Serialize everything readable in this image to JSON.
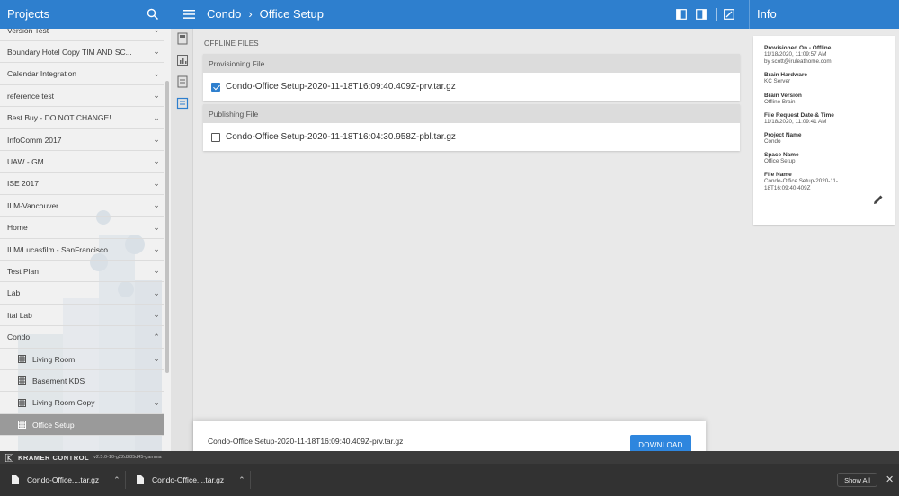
{
  "header": {
    "projects_title": "Projects",
    "breadcrumb": [
      "Condo",
      "Office Setup"
    ],
    "info_title": "Info"
  },
  "sidebar": {
    "items": [
      {
        "label": "Version Test",
        "chevron": "down"
      },
      {
        "label": "Boundary Hotel Copy TIM AND SC...",
        "chevron": "down"
      },
      {
        "label": "Calendar Integration",
        "chevron": "down"
      },
      {
        "label": "reference test",
        "chevron": "down"
      },
      {
        "label": "Best Buy - DO NOT CHANGE!",
        "chevron": "down"
      },
      {
        "label": "InfoComm 2017",
        "chevron": "down"
      },
      {
        "label": "UAW - GM",
        "chevron": "down"
      },
      {
        "label": "ISE 2017",
        "chevron": "down"
      },
      {
        "label": "ILM-Vancouver",
        "chevron": "down"
      },
      {
        "label": "Home",
        "chevron": "down"
      },
      {
        "label": "ILM/Lucasfilm - SanFrancisco",
        "chevron": "down"
      },
      {
        "label": "Test Plan",
        "chevron": "down"
      },
      {
        "label": "Lab",
        "chevron": "down"
      },
      {
        "label": "Itai Lab",
        "chevron": "down"
      },
      {
        "label": "Condo",
        "chevron": "up"
      }
    ],
    "subitems": [
      {
        "label": "Living Room",
        "chevron": "down"
      },
      {
        "label": "Basement KDS",
        "chevron": ""
      },
      {
        "label": "Living Room Copy",
        "chevron": "down"
      },
      {
        "label": "Office Setup",
        "chevron": "",
        "selected": true
      }
    ]
  },
  "main": {
    "section_title": "OFFLINE FILES",
    "provisioning": {
      "heading": "Provisioning File",
      "file": "Condo-Office Setup-2020-11-18T16:09:40.409Z-prv.tar.gz",
      "checked": true
    },
    "publishing": {
      "heading": "Publishing File",
      "file": "Condo-Office Setup-2020-11-18T16:04:30.958Z-pbl.tar.gz",
      "checked": false
    }
  },
  "info": {
    "fields": [
      {
        "key": "Provisioned On - Offline",
        "lines": [
          "11/18/2020, 11:09:57 AM",
          "by scott@iruleathome.com"
        ]
      },
      {
        "key": "Brain Hardware",
        "lines": [
          "KC Server"
        ]
      },
      {
        "key": "Brain Version",
        "lines": [
          "Offline Brain"
        ]
      },
      {
        "key": "File Request Date & Time",
        "lines": [
          "11/18/2020, 11:09:41 AM"
        ]
      },
      {
        "key": "Project Name",
        "lines": [
          "Condo"
        ]
      },
      {
        "key": "Space Name",
        "lines": [
          "Office Setup"
        ]
      },
      {
        "key": "File Name",
        "lines": [
          "Condo-Office Setup-2020-11-",
          "18T16:09:40.409Z"
        ]
      }
    ]
  },
  "download_bar": {
    "filename": "Condo-Office Setup-2020-11-18T16:09:40.409Z-prv.tar.gz",
    "button": "DOWNLOAD"
  },
  "footer": {
    "brand": "KRAMER CONTROL",
    "version": "v2.5.0-10-g22d285d45-gamma"
  },
  "shelf": {
    "items": [
      "Condo-Office....tar.gz",
      "Condo-Office....tar.gz"
    ],
    "show_all": "Show All",
    "close": "✕"
  },
  "colors": {
    "header_blue": "#2e7fce",
    "button_blue": "#2e86de",
    "selected_gray": "#9a9a9a"
  }
}
